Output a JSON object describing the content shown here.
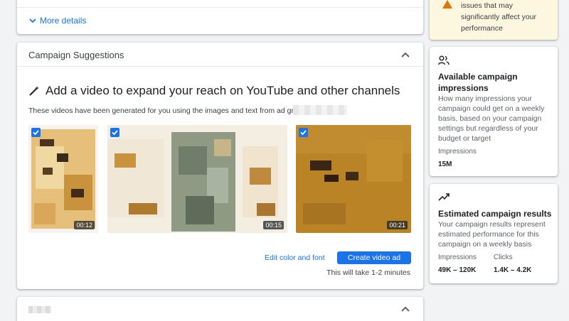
{
  "details": {
    "more_label": "More details"
  },
  "warning": {
    "text": "issues that may significantly affect your performance"
  },
  "suggestions": {
    "title": "Campaign Suggestions",
    "headline": "Add a video to expand your reach on YouTube and other channels",
    "subtext": "These videos have been generated for you using the images and text from ad group",
    "videos": [
      {
        "duration": "00:12",
        "checked": true
      },
      {
        "duration": "00:15",
        "checked": true
      },
      {
        "duration": "00:21",
        "checked": true
      }
    ],
    "edit_link": "Edit color and font",
    "create_button": "Create video ad",
    "time_note": "This will take 1-2 minutes"
  },
  "impressions_card": {
    "icon": "people-icon",
    "title": "Available campaign impressions",
    "description": "How many impressions your campaign could get on a weekly basis, based on your campaign settings but regardless of your budget or target",
    "metric_label": "Impressions",
    "metric_value": "15M"
  },
  "results_card": {
    "icon": "trending-up-icon",
    "title": "Estimated campaign results",
    "description": "Your campaign results represent estimated performance for this campaign on a weekly basis",
    "impressions_label": "Impressions",
    "impressions_value": "49K – 120K",
    "clicks_label": "Clicks",
    "clicks_value": "1.4K – 4.2K"
  },
  "colors": {
    "accent": "#1a73e8",
    "warning_bg": "#fef7e0"
  }
}
